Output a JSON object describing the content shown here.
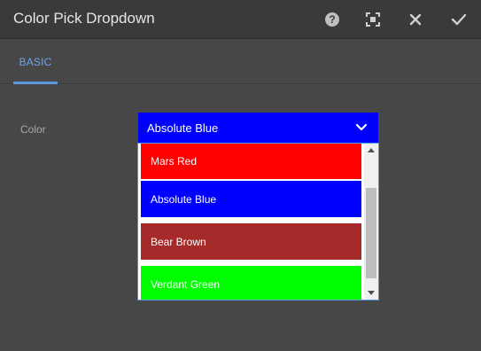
{
  "dialog": {
    "title": "Color Pick Dropdown",
    "actions": [
      "help-icon",
      "fullscreen-icon",
      "close-icon",
      "check-icon"
    ]
  },
  "tabs": [
    {
      "label": "BASIC",
      "active": true
    }
  ],
  "form": {
    "color_label": "Color",
    "selected_value": "Absolute Blue",
    "selected_color": "#0000ff",
    "options": [
      {
        "label": "Mars Red",
        "color": "#ff0000"
      },
      {
        "label": "Absolute Blue",
        "color": "#0000ff"
      },
      {
        "label": "Bear Brown",
        "color": "#a52a2a"
      },
      {
        "label": "Verdant Green",
        "color": "#00ff00"
      }
    ]
  },
  "colors": {
    "background": "#474747",
    "titlebar": "#3a3a3a",
    "accent": "#5c96dc"
  }
}
